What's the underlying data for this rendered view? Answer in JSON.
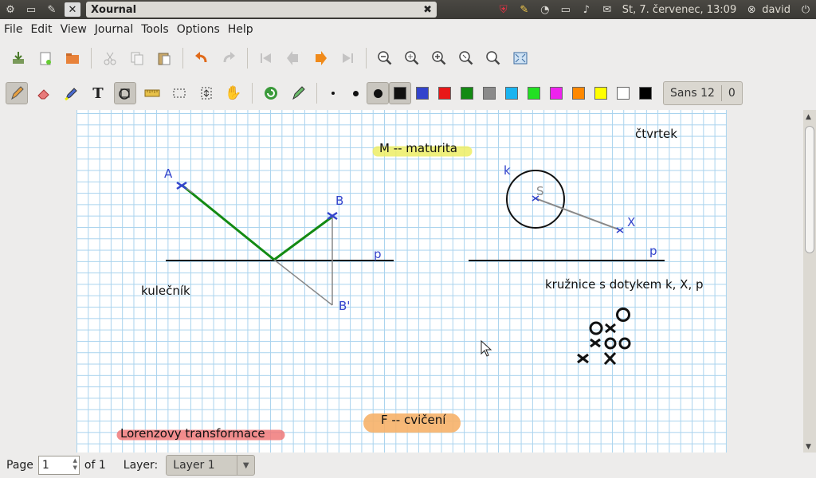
{
  "topbar": {
    "window_title": "Xournal",
    "clock": "St,  7. červenec, 13:09",
    "user": "david"
  },
  "menu": [
    "File",
    "Edit",
    "View",
    "Journal",
    "Tools",
    "Options",
    "Help"
  ],
  "toolbar2": {
    "font_label": "Sans 12",
    "font_extra": "0",
    "colors": [
      "#111111",
      "#3344cc",
      "#e81818",
      "#138a13",
      "#8a8a8a",
      "#1ab4f0",
      "#22e022",
      "#ee22ee",
      "#ff8800",
      "#ffff00",
      "#ffffff",
      "#000000"
    ]
  },
  "canvas": {
    "labels": {
      "A": "A",
      "B": "B",
      "B_prime": "B'",
      "p_left": "p",
      "p_right": "p",
      "k": "k",
      "S": "S",
      "X": "X",
      "kulecnik": "kulečník",
      "ctvrtek": "čtvrtek",
      "maturita": "M -- maturita",
      "kruznice": "kružnice s dotykem k, X, p",
      "lorenz": "Lorenzovy transformace",
      "cviceni": "F -- cvičení"
    }
  },
  "statusbar": {
    "page_label": "Page",
    "page_value": "1",
    "of_label": "of 1",
    "layer_label": "Layer:",
    "layer_value": "Layer 1"
  },
  "icons": {
    "toolbar1": [
      "save-icon",
      "new-icon",
      "open-icon",
      "cut-icon",
      "copy-icon",
      "paste-icon",
      "undo-icon",
      "redo-icon",
      "first-page-icon",
      "prev-page-icon",
      "next-page-icon",
      "last-page-icon",
      "zoom-out-icon",
      "zoom-page-width-icon",
      "zoom-in-icon",
      "zoom-normal-icon",
      "zoom-set-icon",
      "fullscreen-icon"
    ],
    "toolbar2": [
      "pen-icon",
      "eraser-icon",
      "highlighter-icon",
      "text-icon",
      "shape-recognizer-icon",
      "ruler-icon",
      "select-rectangle-icon",
      "vertical-space-icon",
      "hand-icon",
      "default-tool-icon",
      "default-pen-icon"
    ]
  }
}
